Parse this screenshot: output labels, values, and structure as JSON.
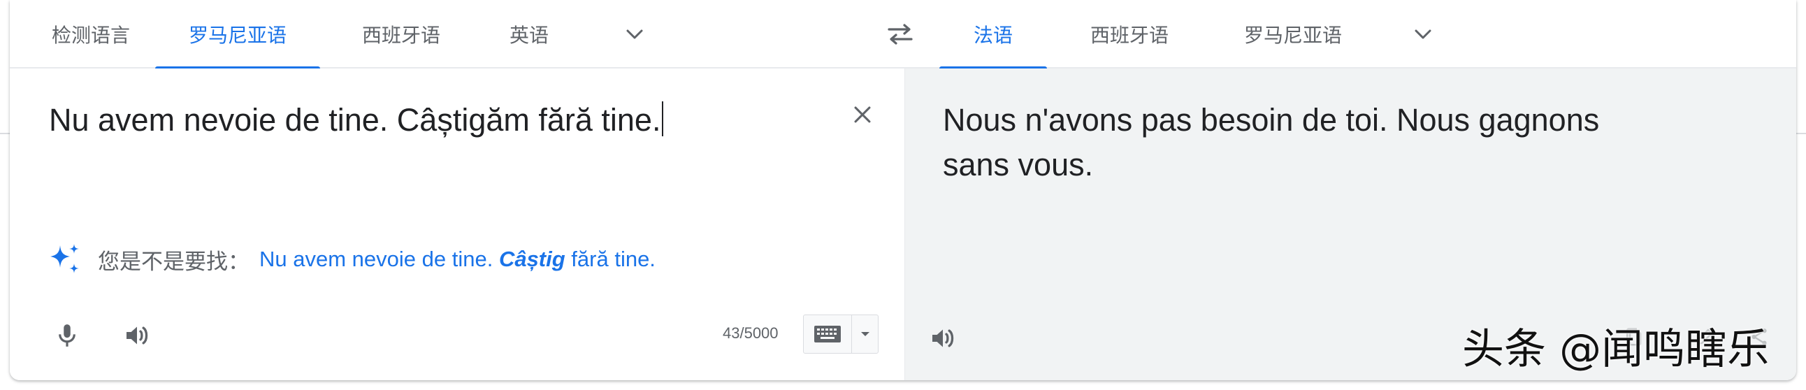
{
  "source_tabs": [
    {
      "label": "检测语言",
      "active": false
    },
    {
      "label": "罗马尼亚语",
      "active": true
    },
    {
      "label": "西班牙语",
      "active": false
    },
    {
      "label": "英语",
      "active": false
    }
  ],
  "target_tabs": [
    {
      "label": "法语",
      "active": true
    },
    {
      "label": "西班牙语",
      "active": false
    },
    {
      "label": "罗马尼亚语",
      "active": false
    }
  ],
  "source": {
    "text": "Nu avem nevoie de tine. Câștigăm fără tine.",
    "char_count": "43/5000"
  },
  "suggestion": {
    "label": "您是不是要找：",
    "before": "Nu avem nevoie de tine. ",
    "emphasis": "Câștig",
    "after": " fără tine."
  },
  "target": {
    "line1": "Nous n'avons pas besoin de toi. Nous gagnons",
    "line2": "sans vous."
  },
  "watermark": "头条 @闻鸣瞎乐",
  "colors": {
    "accent": "#1a73e8",
    "icon_grey": "#5f6368",
    "target_bg": "#f1f3f4"
  },
  "icons": {
    "source_more": "chevron-down-icon",
    "swap": "swap-arrows-icon",
    "target_more": "chevron-down-icon",
    "clear": "close-icon",
    "suggest": "sparkle-icon",
    "mic": "microphone-icon",
    "listen_source": "speaker-icon",
    "keyboard": "keyboard-icon",
    "listen_target": "speaker-icon"
  }
}
